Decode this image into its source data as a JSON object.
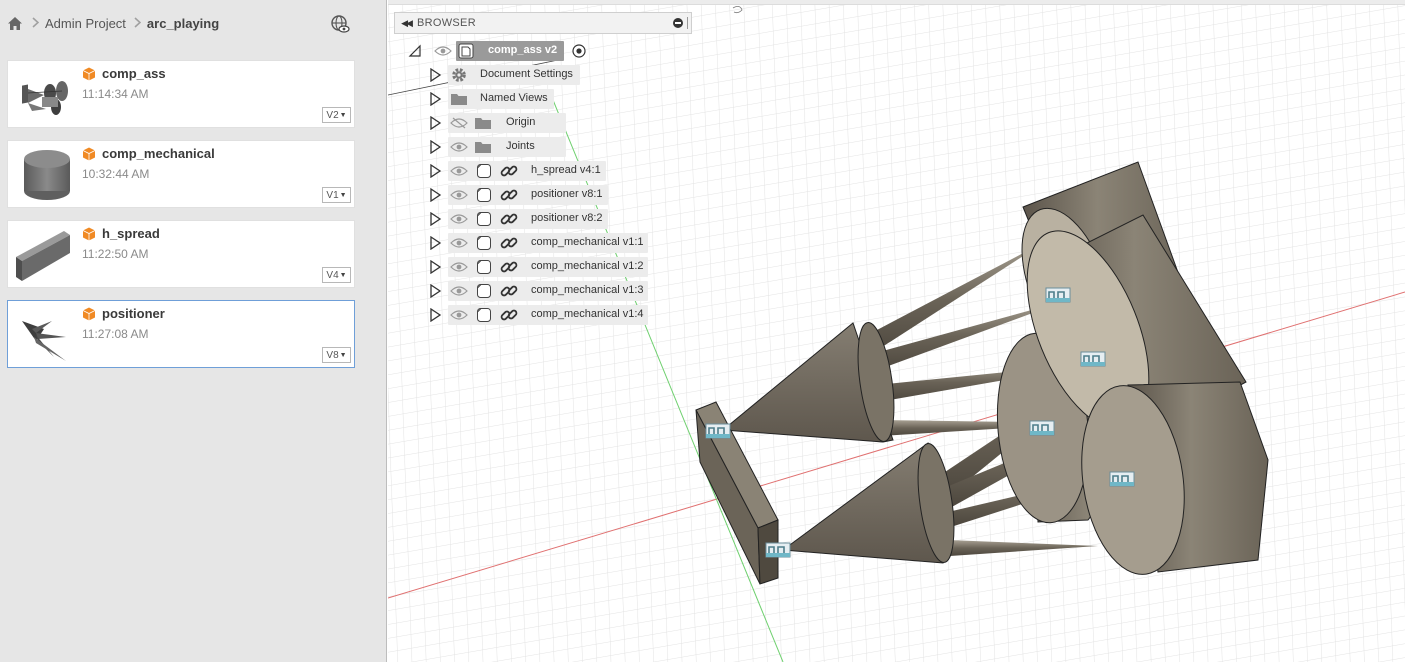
{
  "breadcrumb": {
    "items": [
      "Admin Project",
      "arc_playing"
    ]
  },
  "icons": {
    "home": "home-icon",
    "globe": "globe-eye-icon",
    "component": "orange-cube-icon",
    "eye": "eye-icon",
    "eye_hidden": "eye-slash-icon",
    "folder": "folder-icon",
    "gear": "gear-icon",
    "link": "link-icon",
    "body": "component-box-icon",
    "radio": "activate-radio-icon"
  },
  "files": [
    {
      "name": "comp_ass",
      "time": "11:14:34 AM",
      "version": "V2"
    },
    {
      "name": "comp_mechanical",
      "time": "10:32:44 AM",
      "version": "V1"
    },
    {
      "name": "h_spread",
      "time": "11:22:50 AM",
      "version": "V4"
    },
    {
      "name": "positioner",
      "time": "11:27:08 AM",
      "version": "V8"
    }
  ],
  "browser": {
    "title": "BROWSER",
    "root": "comp_ass v2",
    "folders": [
      {
        "label": "Document Settings"
      },
      {
        "label": "Named Views"
      },
      {
        "label": "Origin"
      },
      {
        "label": "Joints"
      }
    ],
    "components": [
      {
        "label": "h_spread v4:1"
      },
      {
        "label": "positioner v8:1"
      },
      {
        "label": "positioner v8:2"
      },
      {
        "label": "comp_mechanical v1:1"
      },
      {
        "label": "comp_mechanical v1:2"
      },
      {
        "label": "comp_mechanical v1:3"
      },
      {
        "label": "comp_mechanical v1:4"
      }
    ]
  },
  "colors": {
    "panel_bg": "#e6e6e6",
    "selected_border": "#6f9fd8",
    "cube_orange": "#f08a24",
    "model_metal": "#7d7668",
    "axis_red": "#e07070",
    "axis_green": "#6fd06f"
  }
}
